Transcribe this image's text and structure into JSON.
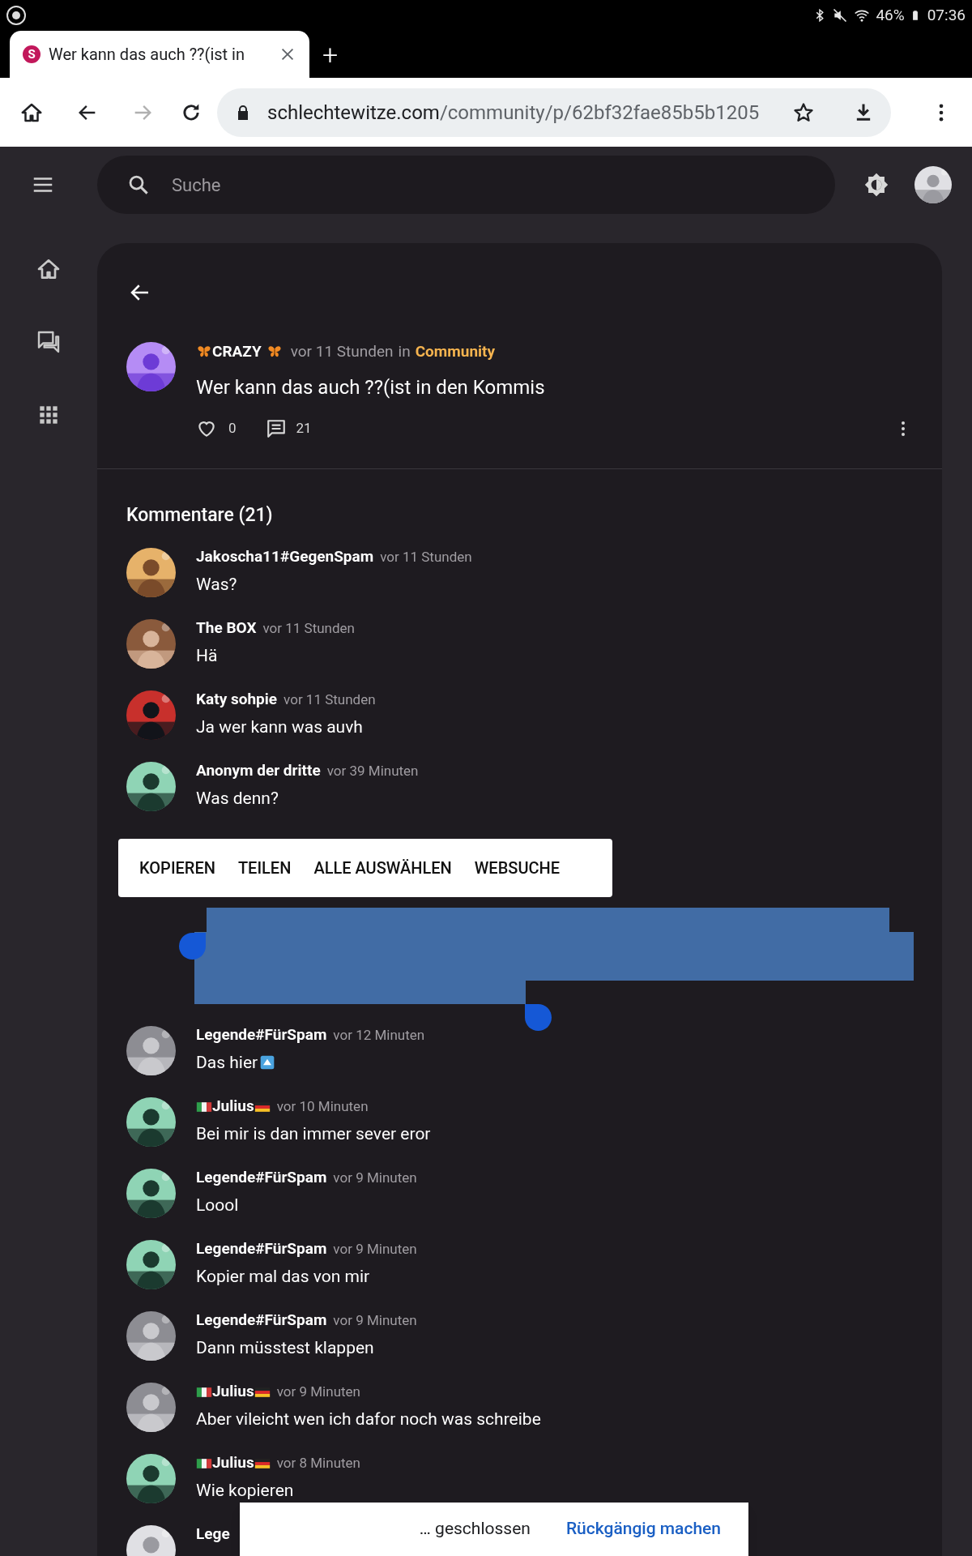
{
  "status_bar": {
    "battery": "46%",
    "time": "07:36"
  },
  "browser": {
    "tab": {
      "favicon": "S",
      "title": "Wer kann das auch ??(ist in",
      "new_tab": "+"
    },
    "url": {
      "domain": "schlechtewitze.com",
      "path": "/community/p/62bf32fae85b5b1205"
    },
    "forward_disabled": true
  },
  "app_bar": {
    "search": {
      "placeholder": "Suche"
    }
  },
  "post": {
    "author": "CRAZY",
    "kind": "decorated",
    "time": "vor 11 Stunden",
    "in": "in",
    "category": "Community",
    "title": "Wer kann das auch ??(ist in den Kommis",
    "likes": "0",
    "comments": "21"
  },
  "comments_heading": "Kommentare (21)",
  "comments": [
    {
      "kind": "plain",
      "author": "Jakoscha11#GegenSpam",
      "time": "vor 11 Stunden",
      "text": "Was?"
    },
    {
      "kind": "plain",
      "author": "The BOX",
      "time": "vor 11 Stunden",
      "text": "Hä"
    },
    {
      "kind": "plain",
      "author": "Katy sohpie",
      "time": "vor 11 Stunden",
      "text": "Ja wer kann was auvh"
    },
    {
      "kind": "plain",
      "author": "Anonym der dritte",
      "time": "vor 39 Minuten",
      "text": "Was denn?"
    },
    {
      "kind": "hidden"
    },
    {
      "kind": "plain",
      "author": "Legende#FürSpam",
      "time": "vor 12 Minuten",
      "text": "Das hier",
      "has_icon": true
    },
    {
      "kind": "flags",
      "author": "Julius",
      "time": "vor 10 Minuten",
      "text": "Bei mir is dan immer sever eror"
    },
    {
      "kind": "plain",
      "author": "Legende#FürSpam",
      "time": "vor 9 Minuten",
      "text": "Loool"
    },
    {
      "kind": "plain",
      "author": "Legende#FürSpam",
      "time": "vor 9 Minuten",
      "text": "Kopier mal das von mir"
    },
    {
      "kind": "plain",
      "author": "Legende#FürSpam",
      "time": "vor 9 Minuten",
      "text": "Dann müsstest klappen"
    },
    {
      "kind": "flags",
      "author": "Julius",
      "time": "vor 9 Minuten",
      "text": "Aber vileicht wen ich dafor noch was schreibe"
    },
    {
      "kind": "flags",
      "author": "Julius",
      "time": "vor 8 Minuten",
      "text": "Wie kopieren"
    },
    {
      "kind": "plain",
      "author": "Lege"
    }
  ],
  "selection_menu": [
    "KOPIEREN",
    "TEILEN",
    "ALLE AUSWÄHLEN",
    "WEBSUCHE"
  ],
  "snackbar": {
    "message": "… geschlossen",
    "action": "Rückgängig machen"
  }
}
